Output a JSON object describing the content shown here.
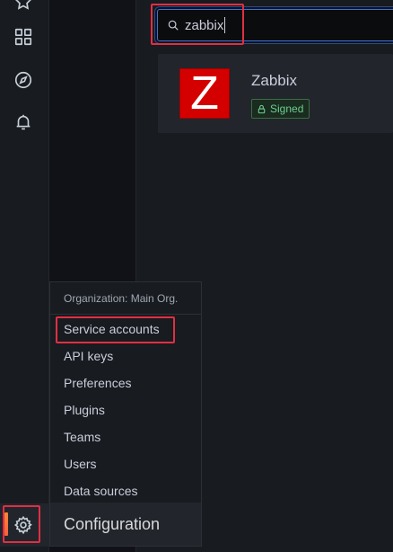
{
  "search": {
    "value": "zabbix"
  },
  "plugin": {
    "name": "Zabbix",
    "logo_letter": "Z",
    "badge": "Signed"
  },
  "menu": {
    "header": "Organization: Main Org.",
    "items": [
      {
        "label": "Service accounts"
      },
      {
        "label": "API keys"
      },
      {
        "label": "Preferences"
      },
      {
        "label": "Plugins"
      },
      {
        "label": "Teams"
      },
      {
        "label": "Users"
      },
      {
        "label": "Data sources"
      }
    ],
    "footer": "Configuration"
  },
  "rail": {
    "icons": [
      "star-icon",
      "dashboards-icon",
      "explore-icon",
      "alerting-icon",
      "gear-icon"
    ]
  },
  "colors": {
    "highlight": "#e02f44",
    "accent": "#3d71d9",
    "signed": "#6ccf8e",
    "logo": "#d40000"
  }
}
